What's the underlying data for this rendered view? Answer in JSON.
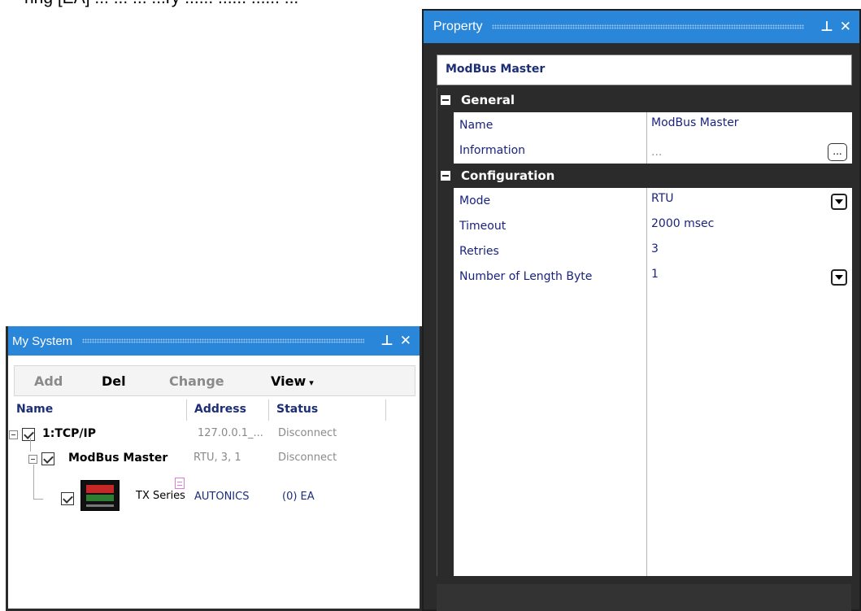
{
  "background_snippet": "ring [EA] ... ... ... ...ry ...... ...... ...... ...",
  "property_window": {
    "title": "Property",
    "pin_glyph": "⊥",
    "close_glyph": "✕",
    "object_name": "ModBus Master",
    "categories": [
      {
        "label": "General",
        "rows": [
          {
            "name": "Name",
            "value": "ModBus Master",
            "editor": "none"
          },
          {
            "name": "Information",
            "value": "...",
            "editor": "ellipsis"
          }
        ]
      },
      {
        "label": "Configuration",
        "rows": [
          {
            "name": "Mode",
            "value": "RTU",
            "editor": "dropdown"
          },
          {
            "name": "Timeout",
            "value": "2000 msec",
            "editor": "none"
          },
          {
            "name": "Retries",
            "value": "3",
            "editor": "none"
          },
          {
            "name": "Number of Length Byte",
            "value": "1",
            "editor": "dropdown"
          }
        ]
      }
    ],
    "ellipsis_label": "..."
  },
  "system_window": {
    "title": "My System",
    "pin_glyph": "⊥",
    "close_glyph": "✕",
    "toolbar": {
      "add": "Add",
      "del": "Del",
      "change": "Change",
      "view": "View",
      "view_caret": "▾"
    },
    "columns": {
      "name": "Name",
      "address": "Address",
      "status": "Status"
    },
    "tree": [
      {
        "label": "1:TCP/IP",
        "address": "127.0.0.1_...",
        "status": "Disconnect"
      },
      {
        "label": "ModBus Master",
        "address": "RTU, 3, 1",
        "status": "Disconnect"
      },
      {
        "label": "TX Series",
        "address": "AUTONICS",
        "status": "(0) EA"
      }
    ]
  }
}
